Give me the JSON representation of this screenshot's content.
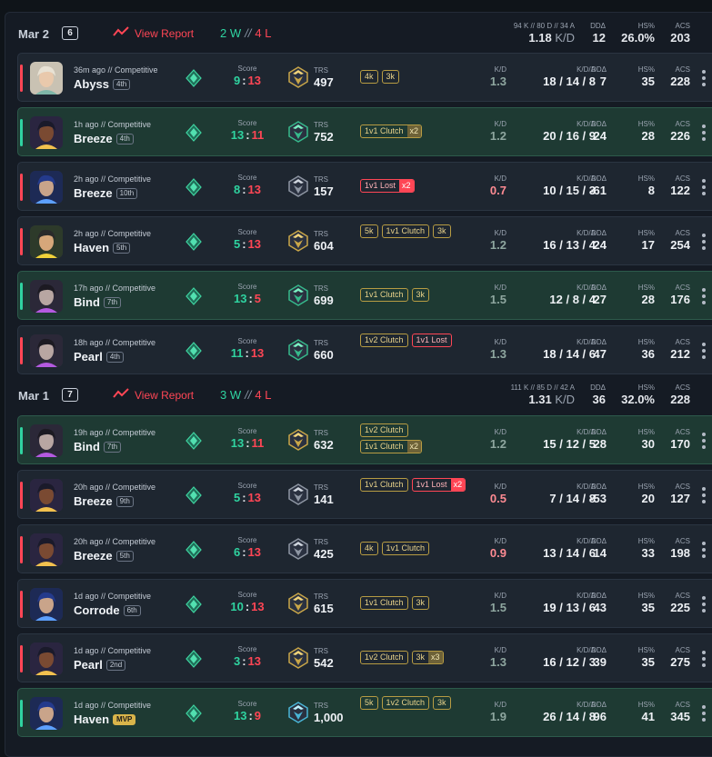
{
  "days": [
    {
      "date": "Mar 2",
      "count": "6",
      "report_label": "View Report",
      "wins": "2 W",
      "losses": "4 L",
      "kda_small": "94 K // 80 D // 34 A",
      "kd_value": "1.18",
      "kd_label": "K/D",
      "dda_label": "DDΔ",
      "dda_value": "12",
      "hs_label": "HS%",
      "hs_value": "26.0%",
      "acs_label": "ACS",
      "acs_value": "203"
    },
    {
      "date": "Mar 1",
      "count": "7",
      "report_label": "View Report",
      "wins": "3 W",
      "losses": "4 L",
      "kda_small": "111 K // 85 D // 42 A",
      "kd_value": "1.31",
      "kd_label": "K/D",
      "dda_label": "DDΔ",
      "dda_value": "36",
      "hs_label": "HS%",
      "hs_value": "32.0%",
      "acs_label": "ACS",
      "acs_value": "228"
    }
  ],
  "labels": {
    "score": "Score",
    "trs": "TRS",
    "kd": "K/D",
    "kda": "K/D/A",
    "dda": "DDΔ",
    "hs": "HS%",
    "acs": "ACS"
  },
  "matches": [
    {
      "result": "loss",
      "agent": "sage",
      "ago": "36m ago // Competitive",
      "map": "Abyss",
      "place": "4th",
      "mvp": false,
      "score_a": "9",
      "score_b": "13",
      "trs_tier": "gold",
      "trs": "497",
      "tags": [
        {
          "t": "4k"
        },
        {
          "t": "3k"
        }
      ],
      "kd": "1.3",
      "kd_color": "gk",
      "kda": "18 / 14 / 8",
      "dda": "7",
      "hs": "35",
      "acs": "228"
    },
    {
      "result": "win",
      "agent": "neon",
      "ago": "1h ago // Competitive",
      "map": "Breeze",
      "place": "4th",
      "mvp": false,
      "score_a": "13",
      "score_b": "11",
      "trs_tier": "green",
      "trs": "752",
      "tags": [
        {
          "t": "1v1 Clutch",
          "m": "x2"
        }
      ],
      "kd": "1.2",
      "kd_color": "gk",
      "kda": "20 / 16 / 9",
      "dda": "24",
      "hs": "28",
      "acs": "226"
    },
    {
      "result": "loss",
      "agent": "yoru",
      "ago": "2h ago // Competitive",
      "map": "Breeze",
      "place": "10th",
      "mvp": false,
      "score_a": "8",
      "score_b": "13",
      "trs_tier": "silver",
      "trs": "157",
      "tags": [
        {
          "t": "1v1 Lost",
          "m": "x2",
          "lost": true
        }
      ],
      "kd": "0.7",
      "kd_color": "bk",
      "kda": "10 / 15 / 3",
      "dda": "-61",
      "hs": "8",
      "acs": "122"
    },
    {
      "result": "loss",
      "agent": "killjoy",
      "ago": "2h ago // Competitive",
      "map": "Haven",
      "place": "5th",
      "mvp": false,
      "score_a": "5",
      "score_b": "13",
      "trs_tier": "gold",
      "trs": "604",
      "tags": [
        {
          "t": "5k"
        },
        {
          "t": "1v1 Clutch"
        },
        {
          "t": "3k"
        }
      ],
      "kd": "1.2",
      "kd_color": "gk",
      "kda": "16 / 13 / 4",
      "dda": "24",
      "hs": "17",
      "acs": "254"
    },
    {
      "result": "win",
      "agent": "reyna",
      "ago": "17h ago // Competitive",
      "map": "Bind",
      "place": "7th",
      "mvp": false,
      "score_a": "13",
      "score_b": "5",
      "trs_tier": "green",
      "trs": "699",
      "tags": [
        {
          "t": "1v1 Clutch"
        },
        {
          "t": "3k"
        }
      ],
      "kd": "1.5",
      "kd_color": "gk",
      "kda": "12 / 8 / 4",
      "dda": "27",
      "hs": "28",
      "acs": "176"
    },
    {
      "result": "loss",
      "agent": "reyna",
      "ago": "18h ago // Competitive",
      "map": "Pearl",
      "place": "4th",
      "mvp": false,
      "score_a": "11",
      "score_b": "13",
      "trs_tier": "green",
      "trs": "660",
      "tags": [
        {
          "t": "1v2 Clutch"
        },
        {
          "t": "1v1 Lost",
          "lost": true
        }
      ],
      "kd": "1.3",
      "kd_color": "gk",
      "kda": "18 / 14 / 6",
      "dda": "47",
      "hs": "36",
      "acs": "212"
    },
    {
      "result": "win",
      "agent": "reyna",
      "ago": "19h ago // Competitive",
      "map": "Bind",
      "place": "7th",
      "mvp": false,
      "score_a": "13",
      "score_b": "11",
      "trs_tier": "gold",
      "trs": "632",
      "tags": [
        {
          "t": "1v2 Clutch"
        },
        {
          "t": "1v1 Clutch",
          "m": "x2"
        }
      ],
      "kd": "1.2",
      "kd_color": "gk",
      "kda": "15 / 12 / 5",
      "dda": "28",
      "hs": "30",
      "acs": "170"
    },
    {
      "result": "loss",
      "agent": "neon",
      "ago": "20h ago // Competitive",
      "map": "Breeze",
      "place": "9th",
      "mvp": false,
      "score_a": "5",
      "score_b": "13",
      "trs_tier": "silver",
      "trs": "141",
      "tags": [
        {
          "t": "1v1 Clutch"
        },
        {
          "t": "1v1 Lost",
          "m": "x2",
          "lost": true
        }
      ],
      "kd": "0.5",
      "kd_color": "bk",
      "kda": "7 / 14 / 8",
      "dda": "-53",
      "hs": "20",
      "acs": "127"
    },
    {
      "result": "loss",
      "agent": "neon",
      "ago": "20h ago // Competitive",
      "map": "Breeze",
      "place": "5th",
      "mvp": false,
      "score_a": "6",
      "score_b": "13",
      "trs_tier": "silver",
      "trs": "425",
      "tags": [
        {
          "t": "4k"
        },
        {
          "t": "1v1 Clutch"
        }
      ],
      "kd": "0.9",
      "kd_color": "bk",
      "kda": "13 / 14 / 6",
      "dda": "14",
      "hs": "33",
      "acs": "198"
    },
    {
      "result": "loss",
      "agent": "yoru",
      "ago": "1d ago // Competitive",
      "map": "Corrode",
      "place": "6th",
      "mvp": false,
      "score_a": "10",
      "score_b": "13",
      "trs_tier": "gold",
      "trs": "615",
      "tags": [
        {
          "t": "1v1 Clutch"
        },
        {
          "t": "3k"
        }
      ],
      "kd": "1.5",
      "kd_color": "gk",
      "kda": "19 / 13 / 6",
      "dda": "43",
      "hs": "35",
      "acs": "225"
    },
    {
      "result": "loss",
      "agent": "neon",
      "ago": "1d ago // Competitive",
      "map": "Pearl",
      "place": "2nd",
      "mvp": false,
      "score_a": "3",
      "score_b": "13",
      "trs_tier": "gold",
      "trs": "542",
      "tags": [
        {
          "t": "1v2 Clutch"
        },
        {
          "t": "3k",
          "m": "x3"
        }
      ],
      "kd": "1.3",
      "kd_color": "gk",
      "kda": "16 / 12 / 3",
      "dda": "39",
      "hs": "35",
      "acs": "275"
    },
    {
      "result": "win",
      "agent": "yoru",
      "ago": "1d ago // Competitive",
      "map": "Haven",
      "place": "MVP",
      "mvp": true,
      "score_a": "13",
      "score_b": "9",
      "trs_tier": "diamond",
      "trs": "1,000",
      "tags": [
        {
          "t": "5k"
        },
        {
          "t": "1v2 Clutch"
        },
        {
          "t": "3k"
        }
      ],
      "kd": "1.9",
      "kd_color": "gk",
      "kda": "26 / 14 / 8",
      "dda": "96",
      "hs": "41",
      "acs": "345"
    }
  ],
  "colors": {
    "win": "#2fd3a0",
    "loss": "#ff4655",
    "win_row": "#1e3a33",
    "loss_row": "#1e2630",
    "tag_gold": "#b79c43"
  },
  "icons": {
    "report": "trending-chart-icon",
    "rank": "rank-gem-icon",
    "trs": "trs-rank-emblem-icon",
    "menu": "kebab-menu-icon"
  }
}
